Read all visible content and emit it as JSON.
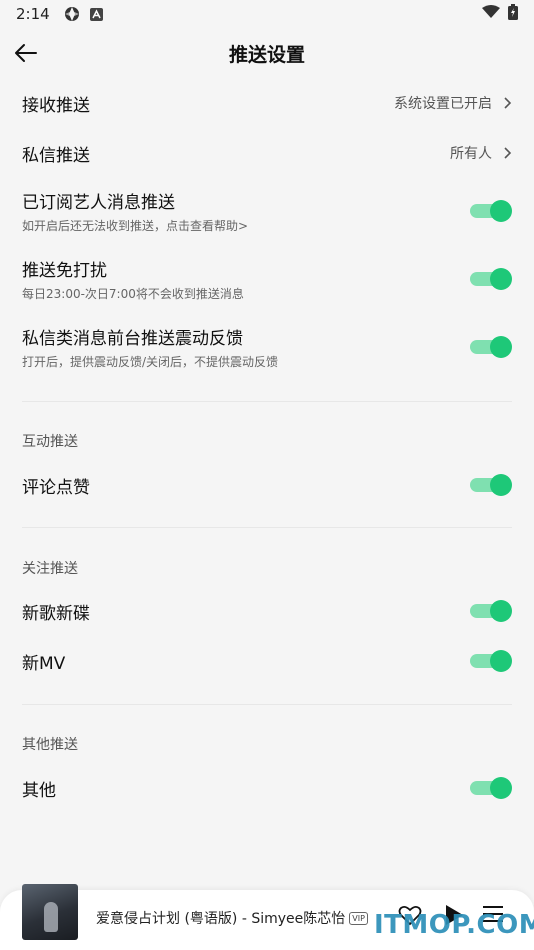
{
  "status_bar": {
    "time": "2:14"
  },
  "header": {
    "title": "推送设置"
  },
  "settings": {
    "receive_push": {
      "label": "接收推送",
      "value": "系统设置已开启"
    },
    "dm_push": {
      "label": "私信推送",
      "value": "所有人"
    },
    "artist_push": {
      "label": "已订阅艺人消息推送",
      "sub": "如开启后还无法收到推送，点击查看帮助>",
      "on": true
    },
    "dnd": {
      "label": "推送免打扰",
      "sub": "每日23:00-次日7:00将不会收到推送消息",
      "on": true
    },
    "dm_vibrate": {
      "label": "私信类消息前台推送震动反馈",
      "sub": "打开后，提供震动反馈/关闭后，不提供震动反馈",
      "on": true
    }
  },
  "sections": {
    "interaction": {
      "header": "互动推送",
      "comment_likes": {
        "label": "评论点赞",
        "on": true
      }
    },
    "follow": {
      "header": "关注推送",
      "new_songs": {
        "label": "新歌新碟",
        "on": true
      },
      "new_mv": {
        "label": "新MV",
        "on": true
      }
    },
    "other": {
      "header": "其他推送",
      "other": {
        "label": "其他",
        "on": true
      }
    }
  },
  "player": {
    "song": "爱意侵占计划 (粤语版) - Simyee陈芯怡",
    "badge": "VIP"
  },
  "watermark": "ITMOP.COM",
  "colors": {
    "toggle_on_knob": "#1ec878",
    "toggle_on_track": "#7fe0b0",
    "background": "#f5f5f5"
  }
}
